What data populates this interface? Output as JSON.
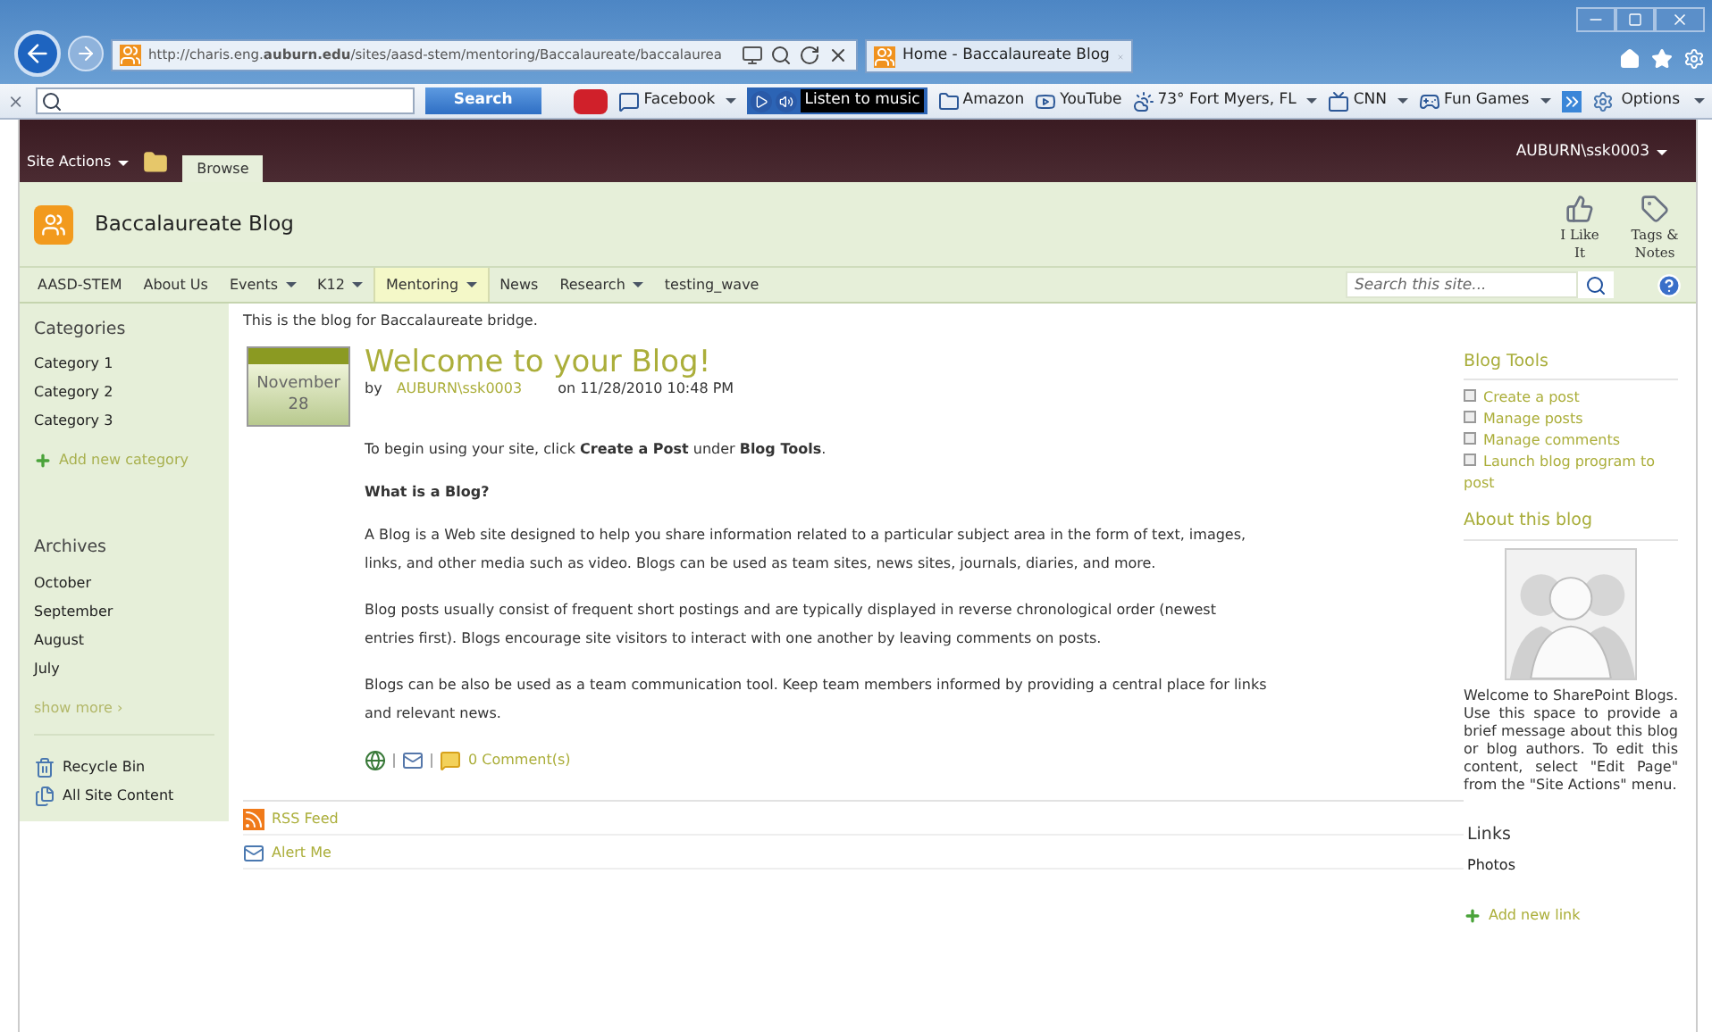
{
  "browser": {
    "address_url": "http://charis.eng.**auburn.edu**/sites/aasd-stem/mentoring/Baccalaureate/baccalaurea",
    "tab_title": "Home - Baccalaureate Blog",
    "toolbar": {
      "search_button": "Search",
      "options": "Options",
      "items": [
        {
          "kind": "link",
          "label": "Facebook",
          "dropdown": true
        },
        {
          "kind": "music",
          "label": "Listen to music",
          "dropdown": false
        },
        {
          "kind": "link",
          "label": "Amazon",
          "dropdown": false
        },
        {
          "kind": "link",
          "label": "YouTube",
          "dropdown": false
        },
        {
          "kind": "link",
          "label": "73° Fort Myers, FL",
          "dropdown": true
        },
        {
          "kind": "link",
          "label": "CNN",
          "dropdown": true
        },
        {
          "kind": "link",
          "label": "Fun Games",
          "dropdown": true
        }
      ]
    }
  },
  "ribbon": {
    "site_actions": "Site Actions",
    "tabs": [
      {
        "label": "Browse",
        "selected": true
      }
    ],
    "user": "AUBURN\\ssk0003"
  },
  "site": {
    "title": "Baccalaureate Blog",
    "actions": [
      "I Like It",
      "Tags & Notes"
    ]
  },
  "nav": {
    "items": [
      {
        "label": "AASD-STEM",
        "dropdown": false,
        "selected": false
      },
      {
        "label": "About Us",
        "dropdown": false,
        "selected": false
      },
      {
        "label": "Events",
        "dropdown": true,
        "selected": false
      },
      {
        "label": "K12",
        "dropdown": true,
        "selected": false
      },
      {
        "label": "Mentoring",
        "dropdown": true,
        "selected": true
      },
      {
        "label": "News",
        "dropdown": false,
        "selected": false
      },
      {
        "label": "Research",
        "dropdown": true,
        "selected": false
      },
      {
        "label": "testing_wave",
        "dropdown": false,
        "selected": false
      }
    ],
    "search_placeholder": "Search this site..."
  },
  "left_nav": {
    "categories": {
      "heading": "Categories",
      "items": [
        "Category 1",
        "Category 2",
        "Category 3"
      ],
      "add": "Add new category"
    },
    "archives": {
      "heading": "Archives",
      "items": [
        "October",
        "September",
        "August",
        "July"
      ],
      "more": "show more ›"
    },
    "bottom": [
      "Recycle Bin",
      "All Site Content"
    ]
  },
  "main": {
    "description": "This is the blog for Baccalaureate bridge.",
    "post": {
      "month": "November",
      "day": "28",
      "title": "Welcome to your Blog!",
      "by": "by",
      "author": "AUBURN\\ssk0003",
      "date": "on 11/28/2010 10:48 PM",
      "body": [
        {
          "kind": "text",
          "text": "To begin using your site, click **Create a Post** under **Blog Tools**."
        },
        {
          "kind": "heading",
          "text": "What is a Blog?"
        },
        {
          "kind": "text",
          "text": "A Blog is a Web site designed to help you share information related to a particular subject area in the form of text, images, links, and other media such as video. Blogs can be used as team sites, news sites, journals, diaries, and more."
        },
        {
          "kind": "text",
          "text": "Blog posts usually consist of frequent short postings and are typically displayed in reverse chronological order (newest entries first). Blogs encourage site visitors to interact with one another by leaving comments on posts."
        },
        {
          "kind": "text",
          "text": "Blogs can be also be used as a team communication tool. Keep team members informed by providing a central place for links and relevant news."
        }
      ],
      "comments": "0 Comment(s)"
    },
    "footer_links": [
      "RSS Feed",
      "Alert Me"
    ]
  },
  "right": {
    "blog_tools": {
      "heading": "Blog Tools",
      "items": [
        "Create a post",
        "Manage posts",
        "Manage comments",
        "Launch blog program to post"
      ]
    },
    "about": {
      "heading": "About this blog",
      "text": "Welcome to SharePoint Blogs. Use this space to provide a brief message about this blog or blog authors. To edit this content, select \"Edit Page\" from the \"Site Actions\" menu."
    },
    "links": {
      "heading": "Links",
      "items": [
        "Photos"
      ],
      "add": "Add new link"
    }
  }
}
